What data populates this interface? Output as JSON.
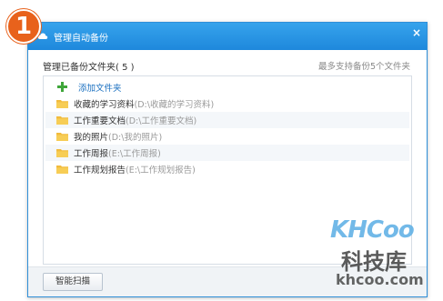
{
  "step_badge": "1",
  "dialog": {
    "title": "管理自动备份",
    "close_label": "×",
    "folders_heading": "管理已备份文件夹( 5 )",
    "max_note": "最多支持备份5个文件夹",
    "add_folder_label": "添加文件夹",
    "folders": [
      {
        "name": "收藏的学习资料",
        "path": "(D:\\收藏的学习资料)"
      },
      {
        "name": "工作重要文档",
        "path": "(D:\\工作重要文档)"
      },
      {
        "name": "我的照片",
        "path": "(D:\\我的照片)"
      },
      {
        "name": "工作周报",
        "path": "(E:\\工作周报)"
      },
      {
        "name": "工作规划报告",
        "path": "(E:\\工作规划报告)"
      }
    ],
    "smart_scan_label": "智能扫描"
  },
  "watermark": {
    "brand": "KHCoo",
    "cn": "科技库",
    "url": "khcoo.com"
  },
  "icons": {
    "title": "cloud-backup-icon",
    "add": "plus-icon",
    "folder": "folder-icon"
  },
  "colors": {
    "titlebar": "#1e88dc",
    "badge": "#e8621c",
    "add_icon": "#3fa63a",
    "folder": "#f2bb3d"
  }
}
